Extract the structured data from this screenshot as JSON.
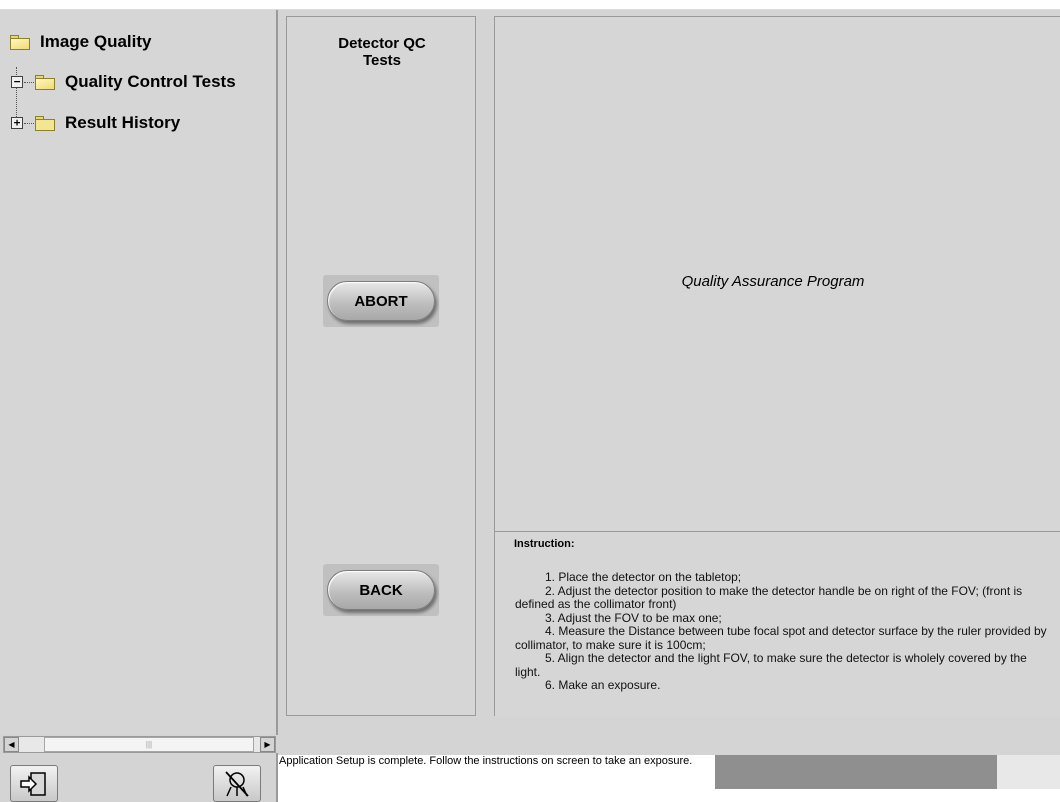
{
  "tree": {
    "root_label": "Image Quality",
    "child1_label": "Quality Control Tests",
    "child2_label": "Result History",
    "expander_open": "−",
    "expander_closed": "+"
  },
  "middle": {
    "title_line1": "Detector QC",
    "title_line2": "Tests",
    "abort_label": "ABORT",
    "back_label": "BACK"
  },
  "main": {
    "title": "Quality Assurance Program",
    "instruction_heading": "Instruction:",
    "instructions": [
      "1. Place the detector on the tabletop;",
      "2. Adjust the detector position to make the detector handle be on right of the FOV; (front is defined as the collimator front)",
      "3. Adjust the FOV to be max one;",
      "4. Measure the Distance between tube focal spot and detector surface by the ruler provided by collimator, to make sure it is 100cm;",
      "5. Align the detector and the light FOV, to make sure the detector is wholely covered by the light.",
      "6. Make an exposure."
    ]
  },
  "status": {
    "message": "Application Setup is complete. Follow the instructions on screen to take an exposure."
  },
  "icons": {
    "exit": "exit-door-icon",
    "xray_off": "xray-tube-off-icon"
  },
  "colors": {
    "panel": "#d6d6d6",
    "folder": "#f3e592",
    "progress": "#8f8f8f"
  }
}
